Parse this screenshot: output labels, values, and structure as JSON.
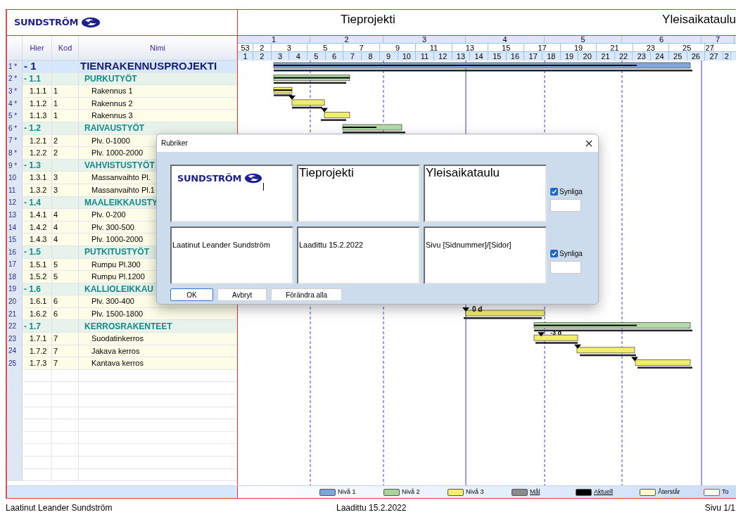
{
  "header": {
    "logo_text": "SUNDSTRÖM",
    "title": "Tieprojekti",
    "subtitle": "Yleisaikataulu"
  },
  "table": {
    "columns": [
      "Hier",
      "Kod",
      "Nimi"
    ],
    "rows": [
      {
        "num": "1 *",
        "hier": "- 1",
        "kod": "",
        "name": "TIENRAKENNUSPROJEKTI",
        "kind": "project"
      },
      {
        "num": "2 *",
        "hier": "- 1.1",
        "kod": "",
        "name": "PURKUTYÖT",
        "kind": "summary"
      },
      {
        "num": "3 *",
        "hier": "1.1.1",
        "kod": "1",
        "name": "Rakennus 1",
        "kind": "task"
      },
      {
        "num": "4 *",
        "hier": "1.1.2",
        "kod": "1",
        "name": "Rakennus 2",
        "kind": "task"
      },
      {
        "num": "5 *",
        "hier": "1.1.3",
        "kod": "1",
        "name": "Rakennus 3",
        "kind": "task"
      },
      {
        "num": "6 *",
        "hier": "- 1.2",
        "kod": "",
        "name": "RAIVAUSTYÖT",
        "kind": "summary"
      },
      {
        "num": "7 *",
        "hier": "1.2.1",
        "kod": "2",
        "name": "Plv. 0-1000",
        "kind": "task"
      },
      {
        "num": "8 *",
        "hier": "1.2.2",
        "kod": "2",
        "name": "Plv. 1000-2000",
        "kind": "task"
      },
      {
        "num": "9 *",
        "hier": "- 1.3",
        "kod": "",
        "name": "VAHVISTUSTYÖT",
        "kind": "summary"
      },
      {
        "num": "10",
        "hier": "1.3.1",
        "kod": "3",
        "name": "Massanvaihto Pl.",
        "kind": "task"
      },
      {
        "num": "11",
        "hier": "1.3.2",
        "kod": "3",
        "name": "Massanvaihto Pl.1",
        "kind": "task"
      },
      {
        "num": "12",
        "hier": "- 1.4",
        "kod": "",
        "name": "MAALEIKKAUSTY",
        "kind": "summary"
      },
      {
        "num": "13",
        "hier": "1.4.1",
        "kod": "4",
        "name": "Plv. 0-200",
        "kind": "task"
      },
      {
        "num": "14",
        "hier": "1.4.2",
        "kod": "4",
        "name": "Plv. 300-500",
        "kind": "task"
      },
      {
        "num": "15",
        "hier": "1.4.3",
        "kod": "4",
        "name": "Plv. 1000-2000",
        "kind": "task"
      },
      {
        "num": "16",
        "hier": "- 1.5",
        "kod": "",
        "name": "PUTKITUSTYÖT",
        "kind": "summary"
      },
      {
        "num": "17",
        "hier": "1.5.1",
        "kod": "5",
        "name": "Rumpu Pl.300",
        "kind": "task"
      },
      {
        "num": "18",
        "hier": "1.5.2",
        "kod": "5",
        "name": "Rumpu Pl.1200",
        "kind": "task"
      },
      {
        "num": "19",
        "hier": "- 1.6",
        "kod": "",
        "name": "KALLIOLEIKKAU",
        "kind": "summary"
      },
      {
        "num": "20",
        "hier": "1.6.1",
        "kod": "6",
        "name": "Plv. 300-400",
        "kind": "task"
      },
      {
        "num": "21",
        "hier": "1.6.2",
        "kod": "6",
        "name": "Plv. 1500-1800",
        "kind": "task"
      },
      {
        "num": "22",
        "hier": "- 1.7",
        "kod": "",
        "name": "KERROSRAKENTEET",
        "kind": "summary"
      },
      {
        "num": "23",
        "hier": "1.7.1",
        "kod": "7",
        "name": "Suodatinkerros",
        "kind": "task"
      },
      {
        "num": "24",
        "hier": "1.7.2",
        "kod": "7",
        "name": "Jakava kerros",
        "kind": "task"
      },
      {
        "num": "25",
        "hier": "1.7.3",
        "kod": "7",
        "name": "Kantava kerros",
        "kind": "task"
      }
    ]
  },
  "timeline": {
    "months": [
      "1",
      "2",
      "3",
      "4",
      "5",
      "6",
      "7"
    ],
    "week_pairs": [
      "53",
      "2",
      "3",
      "5",
      "7",
      "9",
      "11",
      "13",
      "15",
      "17",
      "19",
      "21",
      "23",
      "25",
      "27"
    ],
    "weeks": [
      "1",
      "2",
      "3",
      "4",
      "5",
      "6",
      "7",
      "8",
      "9",
      "10",
      "11",
      "12",
      "13",
      "14",
      "15",
      "16",
      "17",
      "18",
      "19",
      "20",
      "21",
      "22",
      "23",
      "24",
      "25",
      "26",
      "27",
      "2"
    ],
    "lag_labels": [
      "0 d",
      "-3 d"
    ]
  },
  "legend": [
    {
      "label": "Nivå 1",
      "color": "#7fa6dc",
      "underlined": false
    },
    {
      "label": "Nivå 2",
      "color": "#a9d49a",
      "underlined": false
    },
    {
      "label": "Nivå 3",
      "color": "#f2ee6a",
      "underlined": false
    },
    {
      "label": "Mål",
      "color": "#8a8a8a",
      "underlined": true
    },
    {
      "label": "Aktuell",
      "color": "#000000",
      "underlined": true
    },
    {
      "label": "Återstår",
      "color": "#fdfbc8",
      "underlined": false
    },
    {
      "label": "To",
      "color": "#ffffff",
      "underlined": false
    }
  ],
  "footer": {
    "left": "Laatinut Leander Sundström",
    "center": "Laadittu 15.2.2022",
    "right": "Sivu 1/1"
  },
  "dialog": {
    "title": "Rubriker",
    "header_boxes": [
      {
        "kind": "logo",
        "text": "SUNDSTRÖM"
      },
      {
        "kind": "text",
        "text": "Tieprojekti"
      },
      {
        "kind": "text",
        "text": "Yleisaikataulu"
      }
    ],
    "header_visible": {
      "label": "Synliga",
      "checked": true
    },
    "footer_boxes": [
      {
        "kind": "text",
        "text": "Laatinut Leander Sundström"
      },
      {
        "kind": "text",
        "text": "Laadittu 15.2.2022"
      },
      {
        "kind": "text",
        "text": "Sivu [Sidnummer]/[Sidor]"
      }
    ],
    "footer_visible": {
      "label": "Synliga",
      "checked": true
    },
    "buttons": [
      {
        "label": "OK",
        "selected": true
      },
      {
        "label": "Avbryt",
        "selected": false
      },
      {
        "label": "Förändra alla",
        "selected": false
      }
    ]
  }
}
